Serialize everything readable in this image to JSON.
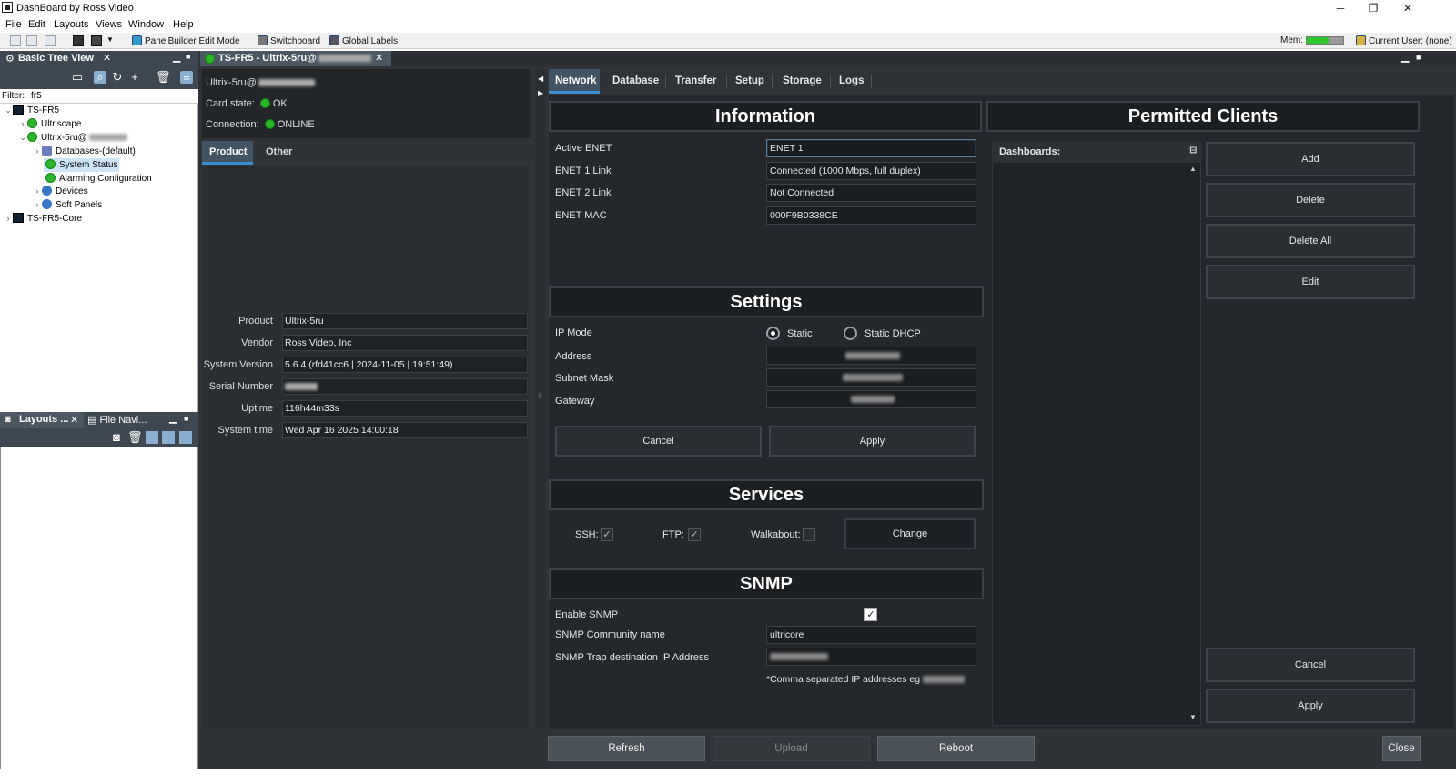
{
  "window": {
    "title": "DashBoard by Ross Video",
    "controls": [
      "─",
      "❐",
      "✕"
    ]
  },
  "menu": [
    "File",
    "Edit",
    "Layouts",
    "Views",
    "Window",
    "Help"
  ],
  "toolbar": {
    "panelbuilder": "PanelBuilder Edit Mode",
    "switchboard": "Switchboard",
    "global_labels": "Global Labels",
    "mem_label": "Mem:",
    "mem_usage": 0.6,
    "current_user": "Current User: (none)"
  },
  "tree_panel": {
    "tab_label": "Basic Tree View",
    "filter_label": "Filter:",
    "filter_value": "fr5",
    "items": [
      {
        "label": "TS-FR5",
        "chev": "⌄"
      },
      {
        "label": "Ultriscape",
        "chev": "›"
      },
      {
        "label": "Ultrix-5ru@",
        "chev": "⌄"
      },
      {
        "label": "Databases-(default)",
        "chev": "›"
      },
      {
        "label": "System Status",
        "chev": ""
      },
      {
        "label": "Alarming Configuration",
        "chev": ""
      },
      {
        "label": "Devices",
        "chev": "›"
      },
      {
        "label": "Soft Panels",
        "chev": "›"
      },
      {
        "label": "TS-FR5-Core",
        "chev": "›"
      }
    ]
  },
  "bottom_left": {
    "tab1": "Layouts ...",
    "tab2": "File Navi..."
  },
  "doc_tab": {
    "label": "TS-FR5 - Ultrix-5ru@"
  },
  "card": {
    "name": "Ultrix-5ru@",
    "state_label": "Card state:",
    "state_value": "OK",
    "conn_label": "Connection:",
    "conn_value": "ONLINE",
    "colors": {
      "ok": "#2bb52b"
    }
  },
  "subtabs": [
    "Product",
    "Other"
  ],
  "product": {
    "rows": [
      {
        "label": "Product",
        "value": "Ultrix-5ru"
      },
      {
        "label": "Vendor",
        "value": "Ross Video, Inc"
      },
      {
        "label": "System Version",
        "value": "5.6.4 (rfd41cc6 | 2024-11-05 | 19:51:49)"
      },
      {
        "label": "Serial Number",
        "value": ""
      },
      {
        "label": "Uptime",
        "value": "116h44m33s"
      },
      {
        "label": "System time",
        "value": "Wed Apr 16 2025  14:00:18"
      }
    ]
  },
  "rtabs": [
    "Network",
    "Database",
    "Transfer",
    "Setup",
    "Storage",
    "Logs"
  ],
  "information": {
    "title": "Information",
    "rows": [
      {
        "label": "Active ENET",
        "value": "ENET 1"
      },
      {
        "label": "ENET 1 Link",
        "value": "Connected (1000 Mbps, full duplex)"
      },
      {
        "label": "ENET 2 Link",
        "value": "Not Connected"
      },
      {
        "label": "ENET MAC",
        "value": "000F9B0338CE"
      }
    ]
  },
  "settings": {
    "title": "Settings",
    "ip_mode_label": "IP Mode",
    "static_label": "Static",
    "dhcp_label": "Static DHCP",
    "address_label": "Address",
    "subnet_label": "Subnet Mask",
    "gateway_label": "Gateway",
    "cancel": "Cancel",
    "apply": "Apply"
  },
  "services": {
    "title": "Services",
    "ssh": "SSH:",
    "ftp": "FTP:",
    "walkabout": "Walkabout:",
    "change": "Change",
    "check": "✓"
  },
  "snmp": {
    "title": "SNMP",
    "enable_label": "Enable SNMP",
    "community_label": "SNMP Community name",
    "community_value": "ultricore",
    "trap_label": "SNMP Trap destination IP Address",
    "note": "*Comma separated IP addresses eg"
  },
  "permitted": {
    "title": "Permitted Clients",
    "dashboards_label": "Dashboards:",
    "buttons": [
      "Add",
      "Delete",
      "Delete All",
      "Edit"
    ],
    "cancel": "Cancel",
    "apply": "Apply"
  },
  "bottom_buttons": {
    "refresh": "Refresh",
    "upload": "Upload",
    "reboot": "Reboot",
    "close": "Close"
  }
}
